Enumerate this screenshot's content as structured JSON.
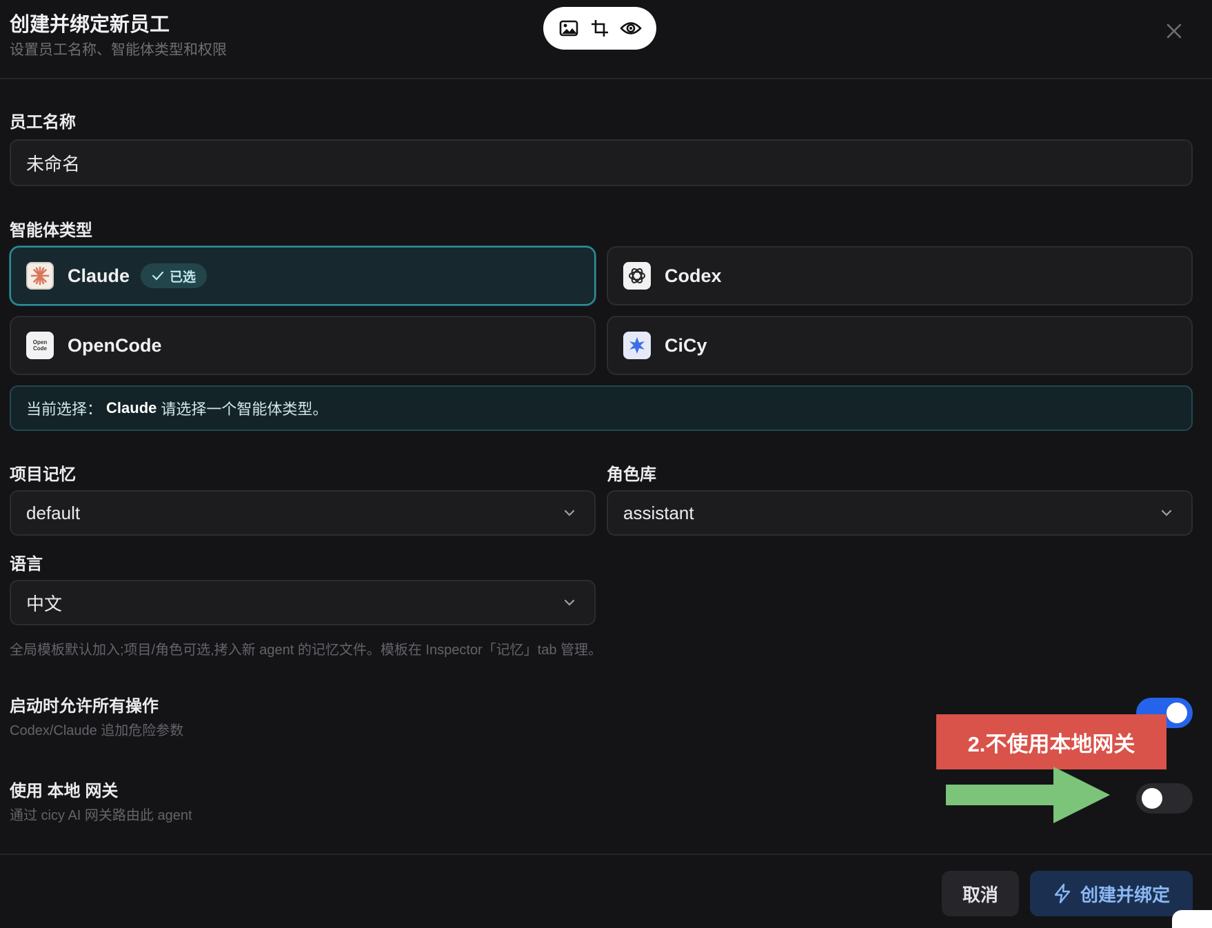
{
  "dialog": {
    "title": "创建并绑定新员工",
    "subtitle": "设置员工名称、智能体类型和权限"
  },
  "toolbar": {
    "items": [
      "image-icon",
      "crop-icon",
      "eye-icon"
    ]
  },
  "employee_name": {
    "label": "员工名称",
    "value": "未命名"
  },
  "agent_type": {
    "label": "智能体类型",
    "options": [
      {
        "name": "Claude",
        "selected": true,
        "icon": "claude-logo-icon"
      },
      {
        "name": "Codex",
        "selected": false,
        "icon": "openai-logo-icon"
      },
      {
        "name": "OpenCode",
        "selected": false,
        "icon": "opencode-logo-icon",
        "icon_text": "Open Code"
      },
      {
        "name": "CiCy",
        "selected": false,
        "icon": "cicy-logo-icon"
      }
    ],
    "selected_badge": "已选",
    "current_prefix": "当前选择：",
    "current_value": "Claude",
    "current_suffix": "请选择一个智能体类型。"
  },
  "project_memory": {
    "label": "项目记忆",
    "value": "default"
  },
  "role_library": {
    "label": "角色库",
    "value": "assistant"
  },
  "language": {
    "label": "语言",
    "value": "中文"
  },
  "hint": "全局模板默认加入;项目/角色可选,拷入新 agent 的记忆文件。模板在 Inspector「记忆」tab 管理。",
  "allow_all": {
    "title": "启动时允许所有操作",
    "subtitle": "Codex/Claude 追加危险参数",
    "on": true
  },
  "local_gateway": {
    "title": "使用 本地 网关",
    "subtitle": "通过 cicy AI 网关路由此 agent",
    "on": false
  },
  "annotation": {
    "text": "2.不使用本地网关"
  },
  "buttons": {
    "cancel": "取消",
    "create": "创建并绑定"
  },
  "colors": {
    "accent_teal": "#2f8f9c",
    "toggle_on": "#2563eb",
    "annotation_red": "#d9534a",
    "annotation_arrow": "#7cc47a",
    "primary_button": "#1b3050"
  }
}
